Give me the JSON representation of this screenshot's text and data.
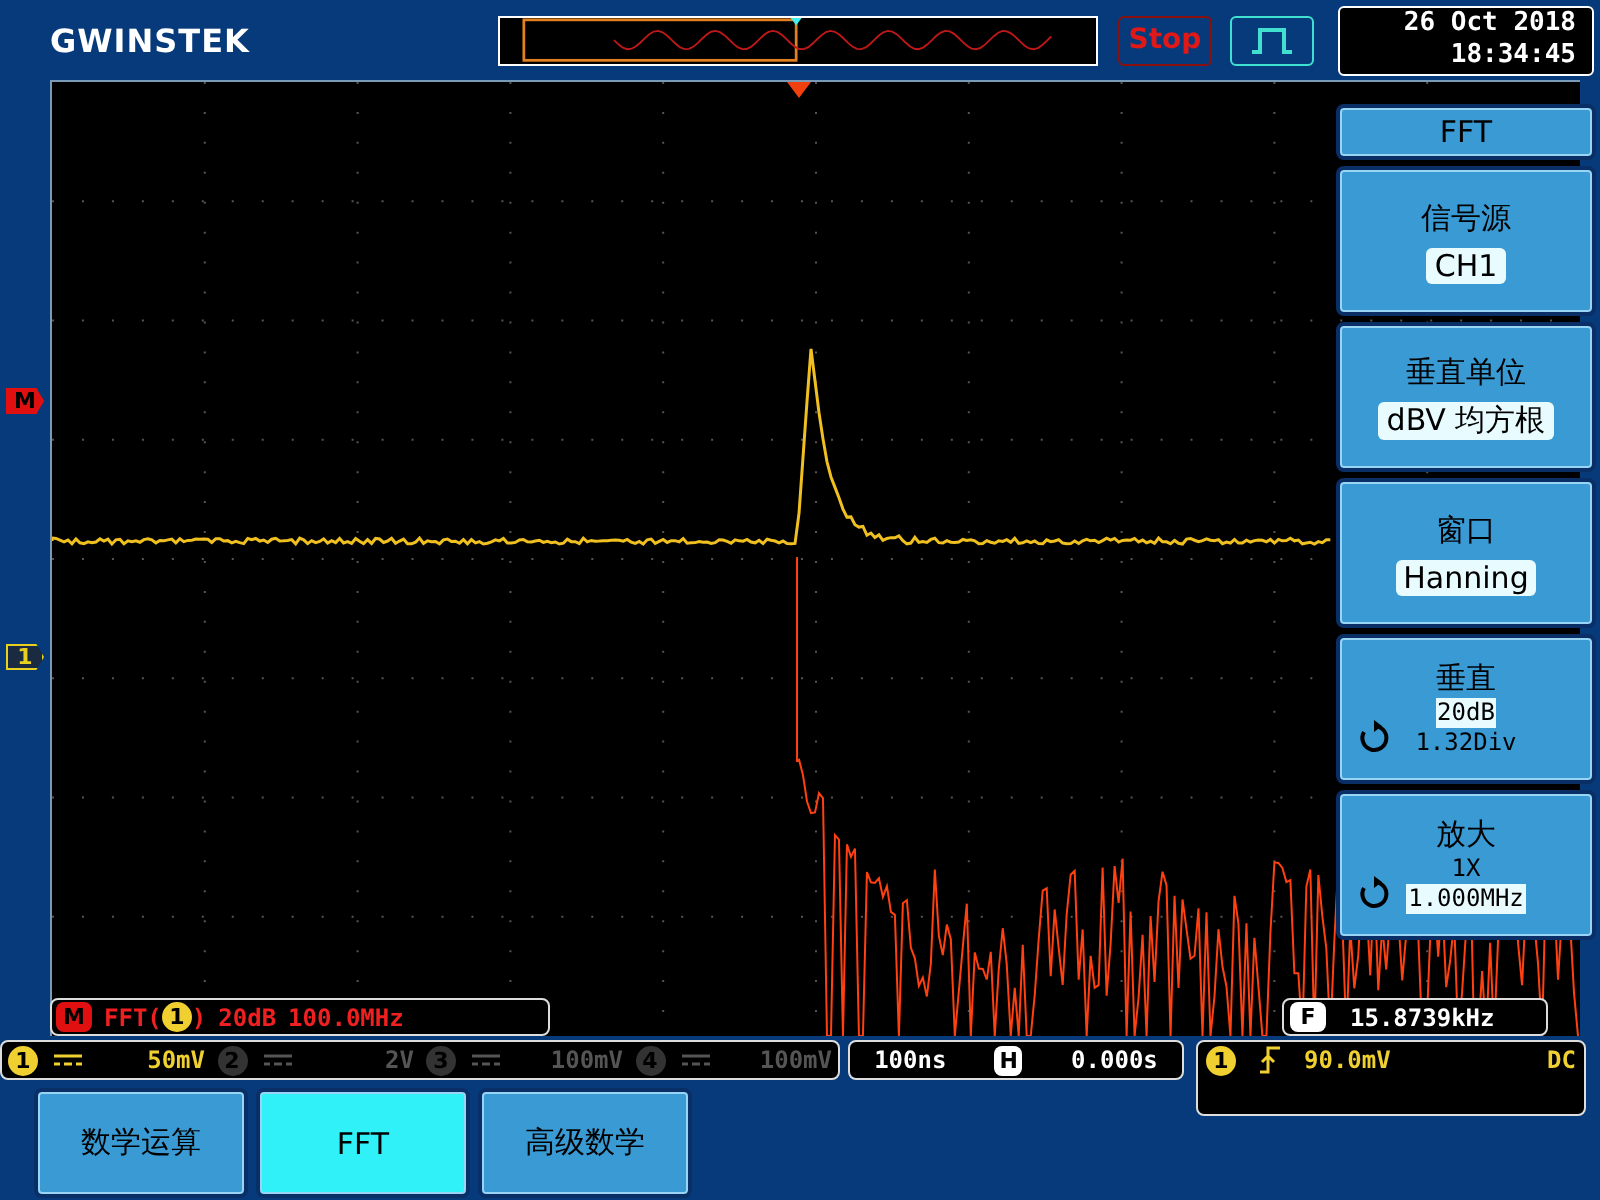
{
  "brand": "GWINSTEK",
  "run_button": {
    "label": "Stop"
  },
  "clock": {
    "date": "26 Oct 2018",
    "time": "18:34:45"
  },
  "markers": [
    {
      "label": "M",
      "color": "#e01010"
    },
    {
      "label": "1",
      "color": "#e8d020"
    }
  ],
  "side_menu": {
    "title": "FFT",
    "items": [
      {
        "kind": "select",
        "label": "信号源",
        "value": "CH1"
      },
      {
        "kind": "select",
        "label": "垂直单位",
        "value": "dBV 均方根"
      },
      {
        "kind": "select",
        "label": "窗口",
        "value": "Hanning"
      },
      {
        "kind": "knob",
        "label": "垂直",
        "lines": [
          {
            "text": "20dB",
            "highlighted": true
          },
          {
            "text": "1.32Div",
            "highlighted": false
          }
        ]
      },
      {
        "kind": "knob",
        "label": "放大",
        "lines": [
          {
            "text": "1X",
            "highlighted": false
          },
          {
            "text": "1.000MHz",
            "highlighted": true
          }
        ]
      }
    ]
  },
  "math_status": {
    "badge": "M",
    "prefix": "FFT(",
    "channel": "1",
    "suffix": ")",
    "scale": "20dB",
    "span": "100.0MHz"
  },
  "frequency": {
    "badge": "F",
    "value": "15.8739kHz"
  },
  "channels": [
    {
      "number": "1",
      "scale": "50mV",
      "on": true
    },
    {
      "number": "2",
      "scale": "2V",
      "on": false
    },
    {
      "number": "3",
      "scale": "100mV",
      "on": false
    },
    {
      "number": "4",
      "scale": "100mV",
      "on": false
    }
  ],
  "timebase": {
    "scale": "100ns",
    "badge": "H",
    "position": "0.000s"
  },
  "trigger": {
    "channel": "1",
    "level": "90.0mV",
    "coupling": "DC"
  },
  "bottom_menu": [
    {
      "label": "数学运算",
      "selected": false
    },
    {
      "label": "FFT",
      "selected": true
    },
    {
      "label": "高级数学",
      "selected": false
    }
  ]
}
